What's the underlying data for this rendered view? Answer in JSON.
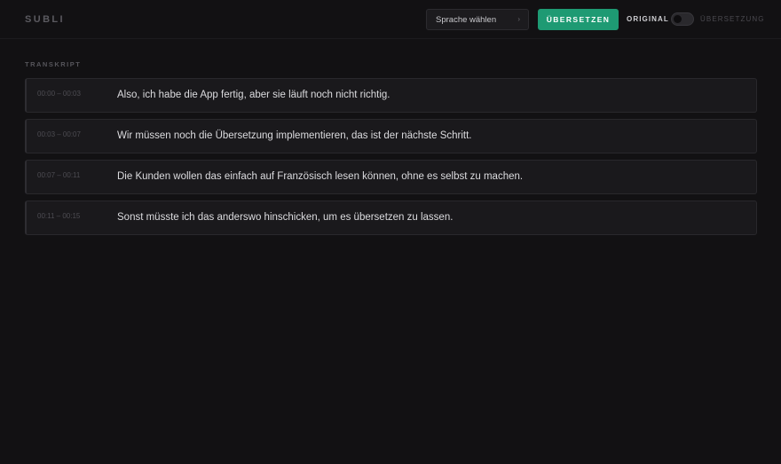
{
  "app": {
    "logo": "SUBLI"
  },
  "header": {
    "language_select": {
      "label": "Sprache wählen",
      "chevron_icon": "chevron-right-icon"
    },
    "translate_button": "ÜBERSETZEN",
    "mode_original": "ORIGINAL",
    "mode_translation": "ÜBERSETZUNG",
    "toggle_state": "original"
  },
  "colors": {
    "background": "#121113",
    "accent": "#1e9a73",
    "card": "#1a191c"
  },
  "transcript": {
    "label": "TRANSKRIPT",
    "segments": [
      {
        "time": "00:00 – 00:03",
        "text": "Also, ich habe die App fertig, aber sie läuft noch nicht richtig."
      },
      {
        "time": "00:03 – 00:07",
        "text": "Wir müssen noch die Übersetzung implementieren, das ist der nächste Schritt."
      },
      {
        "time": "00:07 – 00:11",
        "text": "Die Kunden wollen das einfach auf Französisch lesen können, ohne es selbst zu machen."
      },
      {
        "time": "00:11 – 00:15",
        "text": "Sonst müsste ich das anderswo hinschicken, um es übersetzen zu lassen."
      }
    ]
  }
}
